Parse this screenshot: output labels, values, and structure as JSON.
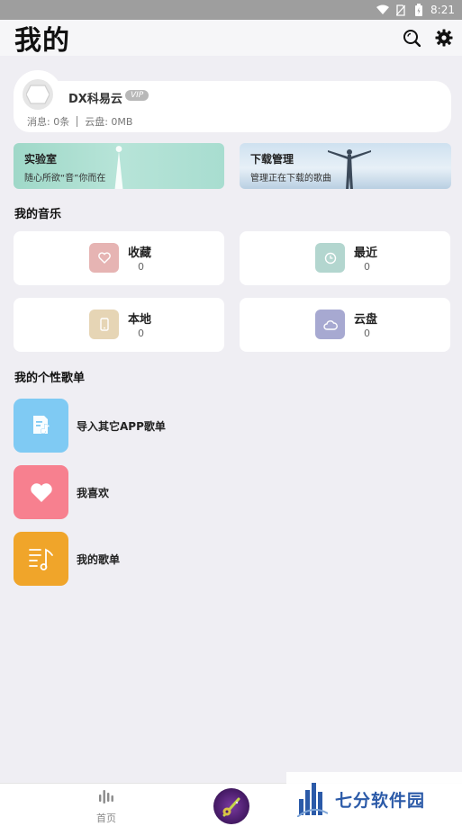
{
  "status_bar": {
    "time": "8:21"
  },
  "header": {
    "title": "我的"
  },
  "profile": {
    "username": "DX科易云",
    "vip_badge": "VIP",
    "messages": "消息: 0条",
    "cloud": "云盘: 0MB"
  },
  "banners": {
    "lab": {
      "title": "实验室",
      "subtitle": "随心所欲“音”你而在"
    },
    "download": {
      "title": "下载管理",
      "subtitle": "管理正在下载的歌曲"
    }
  },
  "my_music": {
    "title": "我的音乐",
    "items": [
      {
        "label": "收藏",
        "count": "0",
        "icon": "heart-icon",
        "color": "#e6b4b3"
      },
      {
        "label": "最近",
        "count": "0",
        "icon": "clock-icon",
        "color": "#b3d6cf"
      },
      {
        "label": "本地",
        "count": "0",
        "icon": "phone-icon",
        "color": "#e6d5b5"
      },
      {
        "label": "云盘",
        "count": "0",
        "icon": "cloud-icon",
        "color": "#a7a9d1"
      }
    ]
  },
  "playlists": {
    "title": "我的个性歌单",
    "items": [
      {
        "label": "导入其它APP歌单",
        "icon": "import-playlist-icon",
        "color": "#7fcaf3"
      },
      {
        "label": "我喜欢",
        "icon": "heart-icon",
        "color": "#f7808f"
      },
      {
        "label": "我的歌单",
        "icon": "music-list-icon",
        "color": "#f0a52a"
      }
    ]
  },
  "bottom_nav": {
    "home_label": "首页"
  },
  "watermark": {
    "text": "七分软件园"
  }
}
